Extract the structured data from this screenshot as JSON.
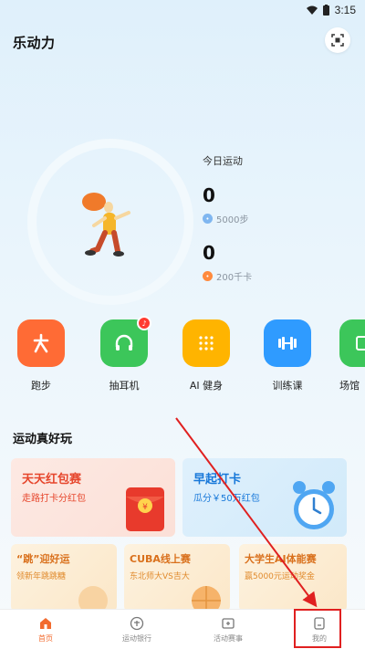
{
  "status": {
    "time": "3:15"
  },
  "app": {
    "title": "乐动力"
  },
  "today": {
    "title": "今日运动",
    "steps": "0",
    "steps_goal": "5000步",
    "calories": "0",
    "calories_goal": "200千卡"
  },
  "categories": [
    {
      "label": "跑步",
      "color": "#ff6b35",
      "icon": "run-icon"
    },
    {
      "label": "抽耳机",
      "color": "#3cc65a",
      "icon": "headphones-icon"
    },
    {
      "label": "AI 健身",
      "color": "#ffb400",
      "icon": "ai-dots-icon"
    },
    {
      "label": "训练课",
      "color": "#2f9bff",
      "icon": "dumbbell-icon"
    },
    {
      "label": "场馆",
      "color": "#3cc65a",
      "icon": "venue-icon"
    }
  ],
  "section": {
    "title": "运动真好玩"
  },
  "cards": {
    "red": {
      "title": "天天红包赛",
      "sub": "走路打卡分红包"
    },
    "blue": {
      "title": "早起打卡",
      "sub": "瓜分￥50万红包"
    },
    "small": [
      {
        "title": "“跳”迎好运",
        "sub": "领新年跳跳糖"
      },
      {
        "title": "CUBA线上赛",
        "sub": "东北师大VS吉大"
      },
      {
        "title": "大学生AI体能赛",
        "sub": "赢5000元运动奖金"
      }
    ]
  },
  "tabs": [
    {
      "label": "首页",
      "active": true
    },
    {
      "label": "运动银行",
      "active": false
    },
    {
      "label": "活动赛事",
      "active": false
    },
    {
      "label": "我的",
      "active": false
    }
  ]
}
